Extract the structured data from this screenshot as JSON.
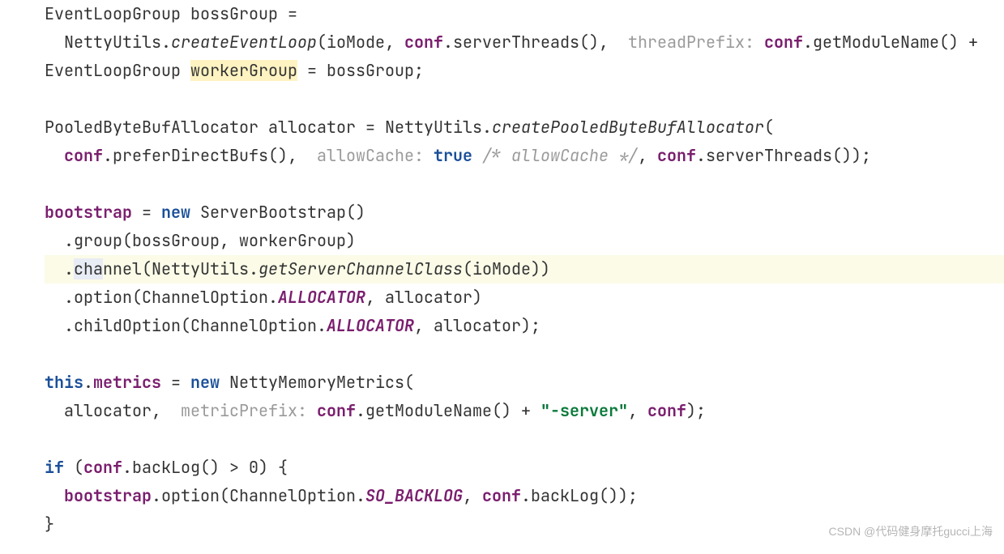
{
  "code": {
    "lines": [
      {
        "i": 0,
        "indent": 0,
        "parts": [
          {
            "t": "EventLoopGroup bossGroup ="
          }
        ]
      },
      {
        "i": 1,
        "indent": 1,
        "parts": [
          {
            "t": "NettyUtils."
          },
          {
            "t": "createEventLoop",
            "cls": "ital"
          },
          {
            "t": "(ioMode, "
          },
          {
            "t": "conf",
            "cls": "field"
          },
          {
            "t": ".serverThreads(),  "
          },
          {
            "t": "threadPrefix:",
            "cls": "hint"
          },
          {
            "t": " "
          },
          {
            "t": "conf",
            "cls": "field"
          },
          {
            "t": ".getModuleName() +"
          }
        ]
      },
      {
        "i": 2,
        "indent": 0,
        "parts": [
          {
            "t": "EventLoopGroup "
          },
          {
            "t": "workerGroup",
            "cls": "hl-yellow"
          },
          {
            "t": " = bossGroup;"
          }
        ]
      },
      {
        "i": 3,
        "indent": 0,
        "parts": [
          {
            "t": ""
          }
        ]
      },
      {
        "i": 4,
        "indent": 0,
        "parts": [
          {
            "t": "PooledByteBufAllocator allocator = NettyUtils."
          },
          {
            "t": "createPooledByteBufAllocator",
            "cls": "ital"
          },
          {
            "t": "("
          }
        ]
      },
      {
        "i": 5,
        "indent": 1,
        "parts": [
          {
            "t": "conf",
            "cls": "field"
          },
          {
            "t": ".preferDirectBufs(),  "
          },
          {
            "t": "allowCache:",
            "cls": "hint"
          },
          {
            "t": " "
          },
          {
            "t": "true",
            "cls": "kw"
          },
          {
            "t": " "
          },
          {
            "t": "/* allowCache */",
            "cls": "cmt"
          },
          {
            "t": ", "
          },
          {
            "t": "conf",
            "cls": "field"
          },
          {
            "t": ".serverThreads());"
          }
        ]
      },
      {
        "i": 6,
        "indent": 0,
        "parts": [
          {
            "t": ""
          }
        ]
      },
      {
        "i": 7,
        "indent": 0,
        "parts": [
          {
            "t": "bootstrap",
            "cls": "field"
          },
          {
            "t": " = "
          },
          {
            "t": "new",
            "cls": "kw"
          },
          {
            "t": " ServerBootstrap()"
          }
        ]
      },
      {
        "i": 8,
        "indent": 1,
        "parts": [
          {
            "t": ".group(bossGroup, workerGroup)"
          }
        ]
      },
      {
        "i": 9,
        "indent": 1,
        "lineHl": true,
        "parts": [
          {
            "t": "."
          },
          {
            "t": "cha",
            "cls": "caret-sel"
          },
          {
            "t": "nnel(NettyUtils."
          },
          {
            "t": "getServerChannelClass",
            "cls": "ital"
          },
          {
            "t": "(ioMode))"
          }
        ]
      },
      {
        "i": 10,
        "indent": 1,
        "parts": [
          {
            "t": ".option(ChannelOption."
          },
          {
            "t": "ALLOCATOR",
            "cls": "const"
          },
          {
            "t": ", allocator)"
          }
        ]
      },
      {
        "i": 11,
        "indent": 1,
        "parts": [
          {
            "t": ".childOption(ChannelOption."
          },
          {
            "t": "ALLOCATOR",
            "cls": "const"
          },
          {
            "t": ", allocator);"
          }
        ]
      },
      {
        "i": 12,
        "indent": 0,
        "parts": [
          {
            "t": ""
          }
        ]
      },
      {
        "i": 13,
        "indent": 0,
        "parts": [
          {
            "t": "this",
            "cls": "kw"
          },
          {
            "t": "."
          },
          {
            "t": "metrics",
            "cls": "field"
          },
          {
            "t": " = "
          },
          {
            "t": "new",
            "cls": "kw"
          },
          {
            "t": " NettyMemoryMetrics("
          }
        ]
      },
      {
        "i": 14,
        "indent": 1,
        "parts": [
          {
            "t": "allocator,  "
          },
          {
            "t": "metricPrefix:",
            "cls": "hint"
          },
          {
            "t": " "
          },
          {
            "t": "conf",
            "cls": "field"
          },
          {
            "t": ".getModuleName() + "
          },
          {
            "t": "\"-server\"",
            "cls": "str"
          },
          {
            "t": ", "
          },
          {
            "t": "conf",
            "cls": "field"
          },
          {
            "t": ");"
          }
        ]
      },
      {
        "i": 15,
        "indent": 0,
        "parts": [
          {
            "t": ""
          }
        ]
      },
      {
        "i": 16,
        "indent": 0,
        "parts": [
          {
            "t": "if",
            "cls": "kw"
          },
          {
            "t": " ("
          },
          {
            "t": "conf",
            "cls": "field"
          },
          {
            "t": ".backLog() > 0) {"
          }
        ]
      },
      {
        "i": 17,
        "indent": 1,
        "parts": [
          {
            "t": "bootstrap",
            "cls": "field"
          },
          {
            "t": ".option(ChannelOption."
          },
          {
            "t": "SO_BACKLOG",
            "cls": "const"
          },
          {
            "t": ", "
          },
          {
            "t": "conf",
            "cls": "field"
          },
          {
            "t": ".backLog());"
          }
        ]
      },
      {
        "i": 18,
        "indent": 0,
        "parts": [
          {
            "t": "}"
          }
        ]
      }
    ],
    "indentUnit": "  "
  },
  "watermark": "CSDN @代码健身摩托gucci上海"
}
